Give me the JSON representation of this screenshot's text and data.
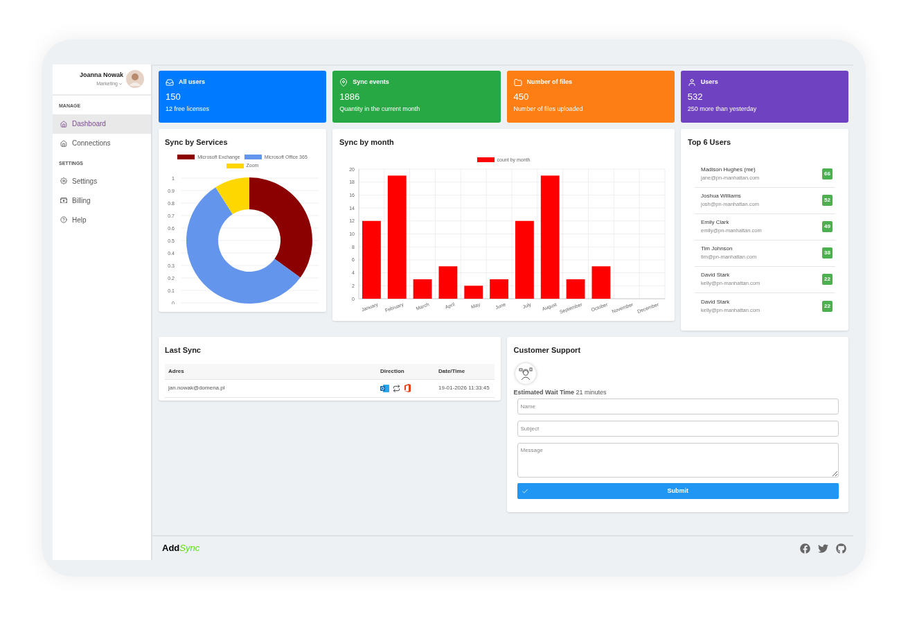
{
  "user": {
    "name": "Joanna Nowak",
    "role": "Marketing"
  },
  "sidebar": {
    "sections": [
      {
        "title": "MANAGE",
        "items": [
          {
            "label": "Dashboard",
            "selected": true
          },
          {
            "label": "Connections",
            "selected": false
          }
        ]
      },
      {
        "title": "SETTINGS",
        "items": [
          {
            "label": "Settings",
            "selected": false
          },
          {
            "label": "Billing",
            "selected": false
          },
          {
            "label": "Help",
            "selected": false
          }
        ]
      }
    ]
  },
  "stats": [
    {
      "title": "All users",
      "value": "150",
      "subtitle": "12 free licenses",
      "color": "#007bff"
    },
    {
      "title": "Sync events",
      "value": "1886",
      "subtitle": "Quantity in the current month",
      "color": "#28a745"
    },
    {
      "title": "Number of files",
      "value": "450",
      "subtitle": "Number of files uploaded",
      "color": "#fd7e14"
    },
    {
      "title": "Users",
      "value": "532",
      "subtitle": "250 more than yesterday",
      "color": "#6f42c1"
    }
  ],
  "services": {
    "title": "Sync by Services",
    "legend": [
      {
        "label": "Microsoft Exchange",
        "color": "#8b0000"
      },
      {
        "label": "Microsoft Office 365",
        "color": "#6495ed"
      },
      {
        "label": "Zoom",
        "color": "#ffd700"
      }
    ],
    "axis_labels": [
      "1",
      "0.9",
      "0.8",
      "0.7",
      "0.6",
      "0.5",
      "0.4",
      "0.3",
      "0.2",
      "0.1",
      "0"
    ]
  },
  "monthly": {
    "title": "Sync by month",
    "chart_data": {
      "type": "bar",
      "categories": [
        "January",
        "February",
        "March",
        "April",
        "May",
        "June",
        "July",
        "August",
        "September",
        "October",
        "November",
        "December"
      ],
      "series": [
        {
          "name": "count by month",
          "color": "#ff0000",
          "values": [
            12,
            19,
            3,
            5,
            2,
            3,
            12,
            19,
            3,
            5,
            null,
            null
          ]
        }
      ],
      "ylim": [
        0,
        20
      ],
      "grid": true,
      "yticks": [
        0,
        2,
        4,
        6,
        8,
        10,
        12,
        14,
        16,
        18,
        20
      ]
    }
  },
  "top_users": {
    "title": "Top 6 Users",
    "users": [
      {
        "name": "Madison Hughes (me)",
        "email": "jane@pn-manhattan.com",
        "count": "66"
      },
      {
        "name": "Joshua Williams",
        "email": "josh@pn-manhattan.com",
        "count": "52"
      },
      {
        "name": "Emily Clark",
        "email": "emily@pn-manhattan.com",
        "count": "49"
      },
      {
        "name": "Tim Johnson",
        "email": "tim@pn-manhattan.com",
        "count": "38"
      },
      {
        "name": "David Stark",
        "email": "kelly@pn-manhattan.com",
        "count": "22"
      },
      {
        "name": "David Stark",
        "email": "kelly@pn-manhattan.com",
        "count": "22"
      }
    ]
  },
  "last_sync": {
    "title": "Last Sync",
    "columns": [
      "Adres",
      "Direction",
      "Date/Time"
    ],
    "rows": [
      {
        "address": "jan.nowak@domena.pl",
        "datetime": "19-01-2026 11:33:45"
      }
    ]
  },
  "support": {
    "title": "Customer Support",
    "wait": "**Estimated Wait Time** 21 minutes",
    "fields": [
      {
        "kind": "input",
        "placeholder": "Name"
      },
      {
        "kind": "textarea_short",
        "placeholder": "Subject"
      },
      {
        "kind": "textarea",
        "placeholder": "Message"
      }
    ],
    "submit": "Submit"
  },
  "footer": {
    "logo_main": "Add",
    "logo_accent": "Sync"
  }
}
